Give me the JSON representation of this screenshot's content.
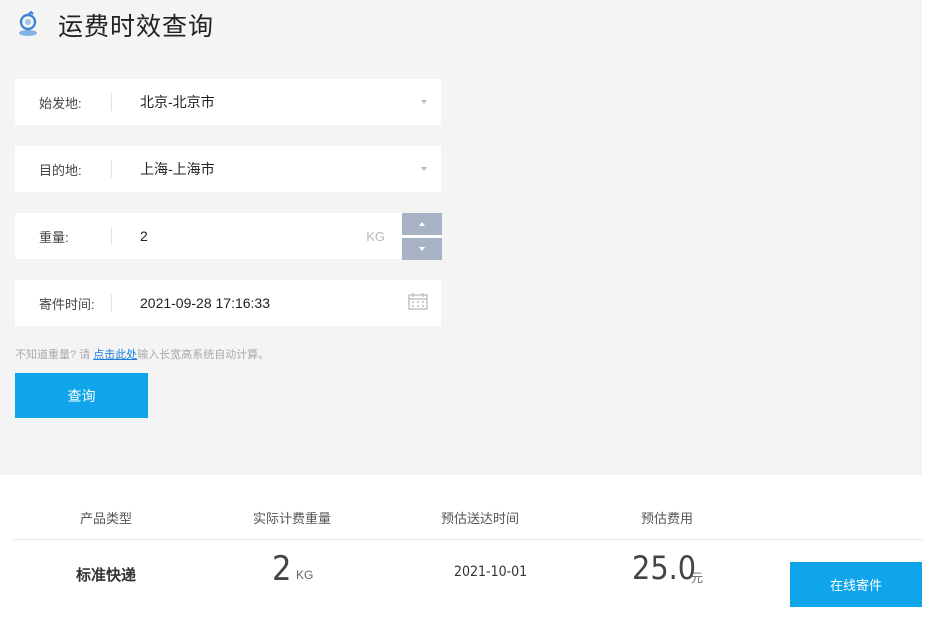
{
  "page": {
    "title": "运费时效查询"
  },
  "form": {
    "origin": {
      "label": "始发地:",
      "value": "北京-北京市"
    },
    "destination": {
      "label": "目的地:",
      "value": "上海-上海市"
    },
    "weight": {
      "label": "重量:",
      "value": "2",
      "unit": "KG"
    },
    "ship_time": {
      "label": "寄件时间:",
      "value": "2021-09-28 17:16:33"
    },
    "hint": {
      "prefix": "不知道重量? 请",
      "link": "点击此处",
      "suffix": "输入长宽高系统自动计算。"
    },
    "query_button": "查询"
  },
  "results": {
    "headers": [
      "产品类型",
      "实际计费重量",
      "预估送达时间",
      "预估费用"
    ],
    "row": {
      "product": "标准快递",
      "weight_value": "2",
      "weight_unit": "KG",
      "delivery_date": "2021-10-01",
      "cost_value": "25.0",
      "cost_unit": "元",
      "action": "在线寄件"
    }
  },
  "colors": {
    "accent": "#10a5ea",
    "link": "#1a7fd6",
    "stepper": "#a7b3c4"
  }
}
